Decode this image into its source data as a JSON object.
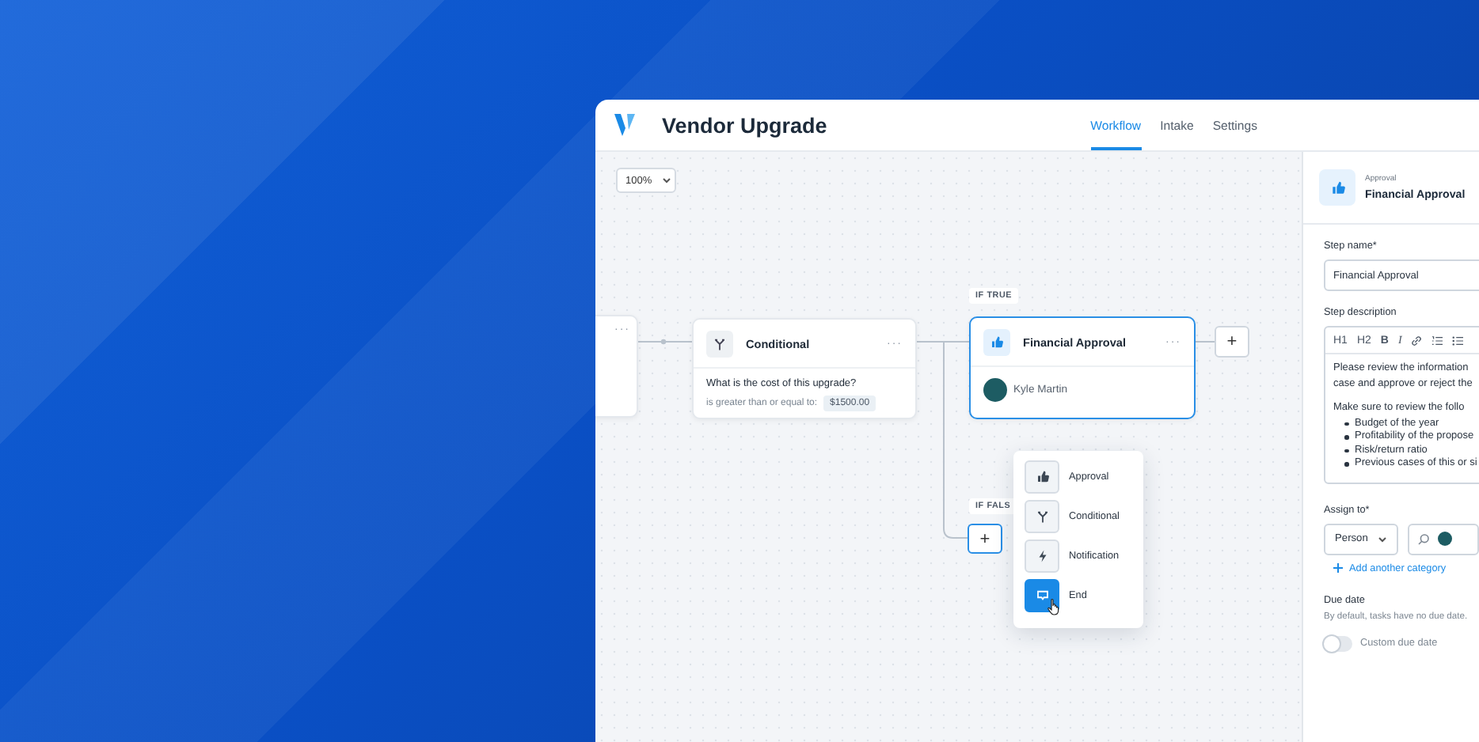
{
  "app": {
    "title": "Vendor Upgrade",
    "tabs": [
      {
        "label": "Workflow",
        "selected": true
      },
      {
        "label": "Intake",
        "selected": false
      },
      {
        "label": "Settings",
        "selected": false
      }
    ]
  },
  "canvas": {
    "zoom": "100%",
    "nodes": [
      {
        "kind": "partial",
        "menu": "···",
        "selected": false
      },
      {
        "kind": "conditional",
        "title": "Conditional",
        "menu": "···",
        "question": "What is the cost of this upgrade?",
        "operator": "is greater than or equal to:",
        "value": "$1500.00",
        "selected": false
      },
      {
        "kind": "approval",
        "title": "Financial Approval",
        "menu": "···",
        "assignee": "Kyle Martin",
        "selected": true
      }
    ],
    "branches": [
      {
        "label": "IF TRUE"
      },
      {
        "label": "IF FALS"
      }
    ],
    "add_buttons": [
      {
        "label": "+",
        "selected": false
      },
      {
        "label": "+",
        "selected": true
      }
    ],
    "step_menu": [
      {
        "kind": "approval",
        "label": "Approval",
        "selected": false
      },
      {
        "kind": "conditional",
        "label": "Conditional",
        "selected": false
      },
      {
        "kind": "notification",
        "label": "Notification",
        "selected": false
      },
      {
        "kind": "end",
        "label": "End",
        "selected": true
      }
    ]
  },
  "panel": {
    "step_type": "Approval",
    "step_title": "Financial Approval",
    "step_name": {
      "label": "Step name*",
      "value": "Financial Approval"
    },
    "description": {
      "label": "Step description",
      "toolbar": [
        {
          "kind": "text",
          "label": "H1"
        },
        {
          "kind": "text",
          "label": "H2"
        },
        {
          "kind": "bold",
          "label": "B"
        },
        {
          "kind": "italic",
          "label": "I"
        },
        {
          "kind": "link"
        },
        {
          "kind": "numbered"
        },
        {
          "kind": "bulleted"
        }
      ],
      "paragraphs": [
        {
          "lines": [
            "Please review the information",
            "case and approve or reject the"
          ]
        },
        {
          "lines": [
            "Make sure to review the follo"
          ]
        }
      ],
      "bullets": [
        "Budget of the year",
        "Profitability of the propose",
        "Risk/return ratio",
        "Previous cases of this or si"
      ]
    },
    "assign": {
      "label": "Assign to*",
      "type": "Person",
      "add": "Add another category"
    },
    "due": {
      "label": "Due date",
      "hint": "By default, tasks have no due date.",
      "toggle_label": "Custom due date",
      "on": false
    }
  }
}
